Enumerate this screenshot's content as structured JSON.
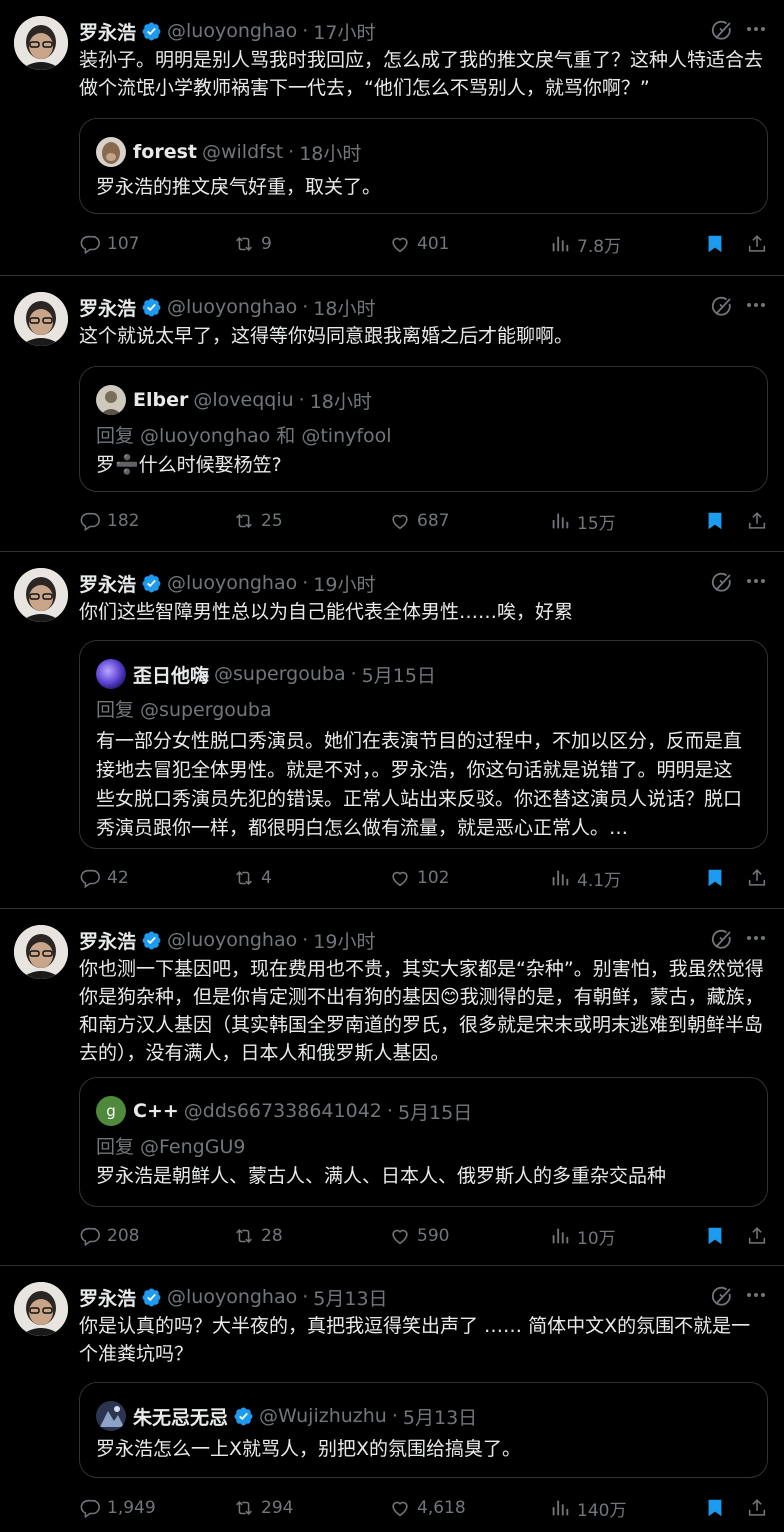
{
  "colors": {
    "background": "#000000",
    "text": "#e7e9ea",
    "muted": "#71767b",
    "accent": "#1d9bf0",
    "border": "#2f3336"
  },
  "icons": {
    "verified": "verified-badge-icon",
    "grok": "grok-icon",
    "more": "more-icon",
    "reply": "reply-icon",
    "retweet": "retweet-icon",
    "like": "heart-icon",
    "views": "views-icon",
    "bookmark": "bookmark-icon",
    "share": "share-icon"
  },
  "tweets": [
    {
      "name": "罗永浩",
      "handle": "@luoyonghao",
      "time": "17小时",
      "text": "装孙子。明明是别人骂我时我回应，怎么成了我的推文戾气重了？这种人特适合去做个流氓小学教师祸害下一代去，“他们怎么不骂别人，就骂你啊？”",
      "quote": {
        "name": "forest",
        "handle": "@wildfst",
        "time": "18小时",
        "reply_to": "",
        "text": "罗永浩的推文戾气好重，取关了。"
      },
      "stats": {
        "replies": "107",
        "retweets": "9",
        "likes": "401",
        "views": "7.8万"
      }
    },
    {
      "name": "罗永浩",
      "handle": "@luoyonghao",
      "time": "18小时",
      "text": "这个就说太早了，这得等你妈同意跟我离婚之后才能聊啊。",
      "quote": {
        "name": "Elber",
        "handle": "@loveqqiu",
        "time": "18小时",
        "reply_to": "回复 @luoyonghao 和 @tinyfool",
        "text": "罗➗什么时候娶杨笠?"
      },
      "stats": {
        "replies": "182",
        "retweets": "25",
        "likes": "687",
        "views": "15万"
      }
    },
    {
      "name": "罗永浩",
      "handle": "@luoyonghao",
      "time": "19小时",
      "text": "你们这些智障男性总以为自己能代表全体男性……唉，好累",
      "quote": {
        "name": "歪日他嗨",
        "handle": "@supergouba",
        "time": "5月15日",
        "reply_to": "回复 @supergouba",
        "text": "有一部分女性脱口秀演员。她们在表演节目的过程中，不加以区分，反而是直接地去冒犯全体男性。就是不对，。罗永浩，你这句话就是说错了。明明是这些女脱口秀演员先犯的错误。正常人站出来反驳。你还替这演员人说话？脱口秀演员跟你一样，都很明白怎么做有流量，就是恶心正常人。…"
      },
      "stats": {
        "replies": "42",
        "retweets": "4",
        "likes": "102",
        "views": "4.1万"
      }
    },
    {
      "name": "罗永浩",
      "handle": "@luoyonghao",
      "time": "19小时",
      "text": "你也测一下基因吧，现在费用也不贵，其实大家都是“杂种”。别害怕，我虽然觉得你是狗杂种，但是你肯定测不出有狗的基因😊我测得的是，有朝鲜，蒙古，藏族，和南方汉人基因（其实韩国全罗南道的罗氏，很多就是宋末或明末逃难到朝鲜半岛去的），没有满人，日本人和俄罗斯人基因。",
      "quote": {
        "name": "C++",
        "handle": "@dds667338641042",
        "time": "5月15日",
        "reply_to": "回复 @FengGU9",
        "text": "罗永浩是朝鲜人、蒙古人、满人、日本人、俄罗斯人的多重杂交品种"
      },
      "stats": {
        "replies": "208",
        "retweets": "28",
        "likes": "590",
        "views": "10万"
      }
    },
    {
      "name": "罗永浩",
      "handle": "@luoyonghao",
      "time": "5月13日",
      "text": "你是认真的吗？大半夜的，真把我逗得笑出声了 …… 简体中文X的氛围不就是一个准粪坑吗？",
      "quote": {
        "name": "朱无忌无忌",
        "handle": "@Wujizhuzhu",
        "time": "5月13日",
        "reply_to": "",
        "text": "罗永浩怎么一上X就骂人，别把X的氛围给搞臭了。"
      },
      "stats": {
        "replies": "1,949",
        "retweets": "294",
        "likes": "4,618",
        "views": "140万"
      }
    }
  ]
}
